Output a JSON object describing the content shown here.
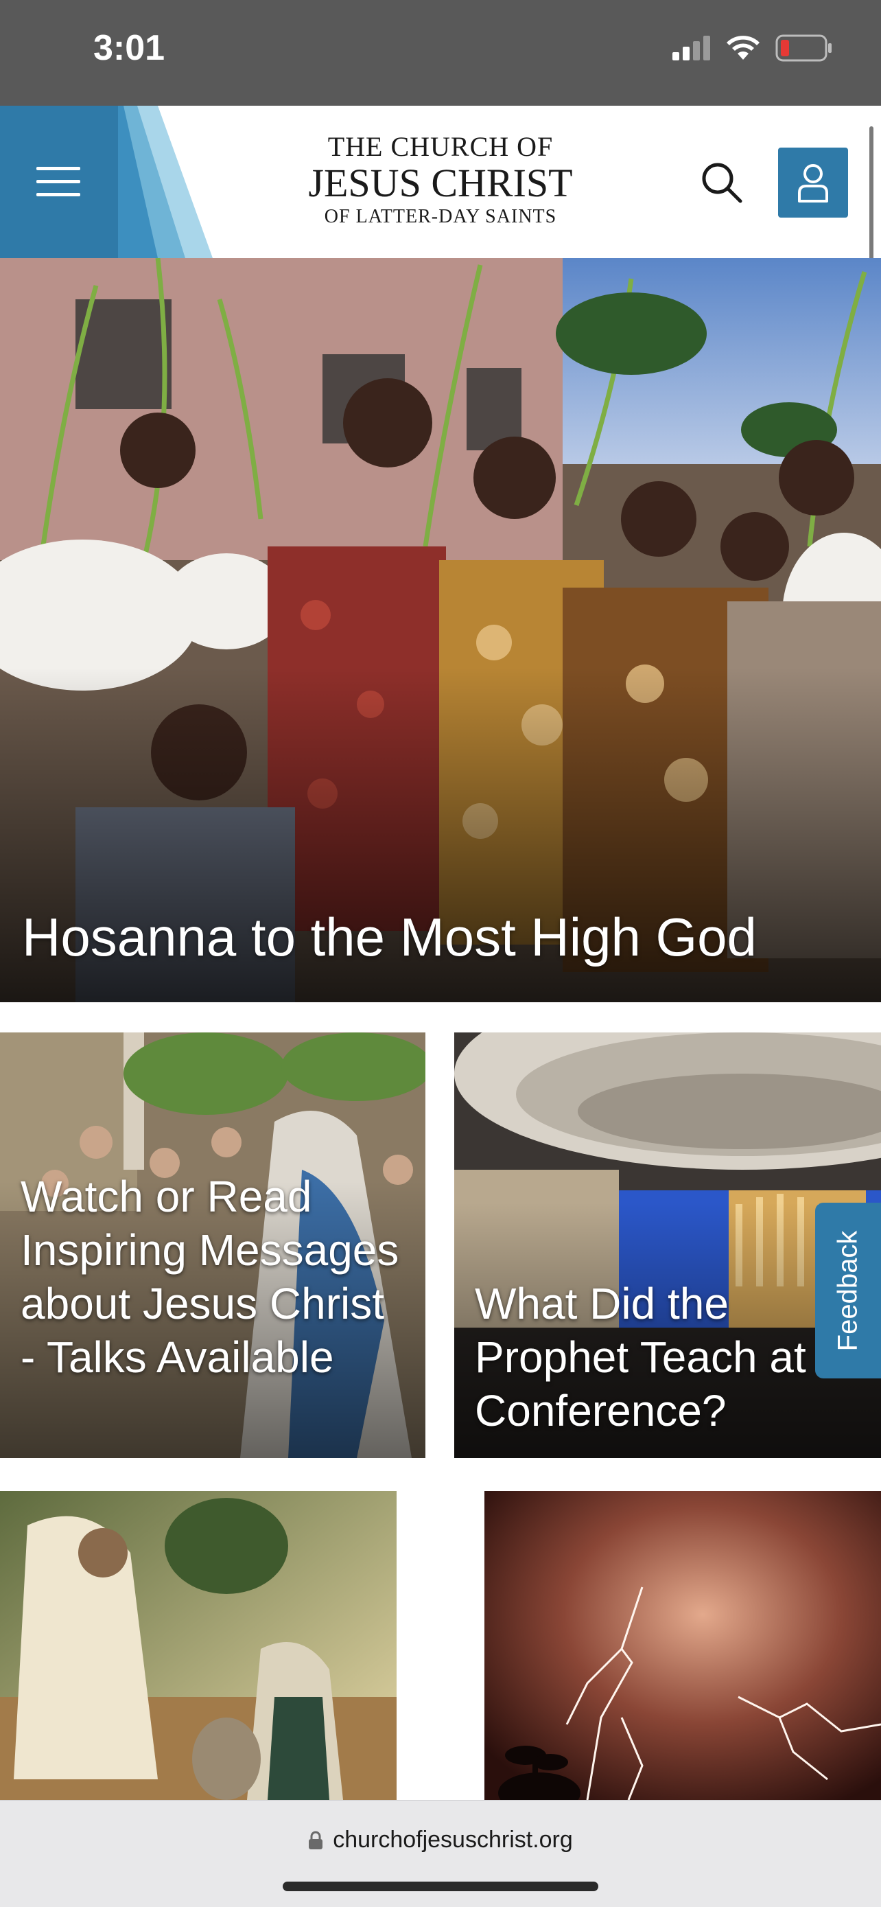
{
  "status_bar": {
    "time": "3:01"
  },
  "header": {
    "logo": {
      "line1": "THE CHURCH OF",
      "line2": "JESUS CHRIST",
      "line3": "OF LATTER-DAY SAINTS"
    },
    "icons": {
      "menu": "hamburger-menu-icon",
      "search": "search-icon",
      "account": "user-icon"
    }
  },
  "hero": {
    "title": "Hosanna to the Most High God"
  },
  "cards": [
    {
      "title": "Watch or Read Inspiring Messages about Jesus Christ - Talks Available"
    },
    {
      "title": "What Did the Prophet Teach at Conference?"
    },
    {
      "title": ""
    },
    {
      "title": ""
    }
  ],
  "feedback": {
    "label": "Feedback"
  },
  "browser": {
    "url": "churchofjesuschrist.org"
  },
  "colors": {
    "accent": "#2f7aa8",
    "status_bar": "#595959",
    "browser_bar": "#e8e8ea"
  }
}
